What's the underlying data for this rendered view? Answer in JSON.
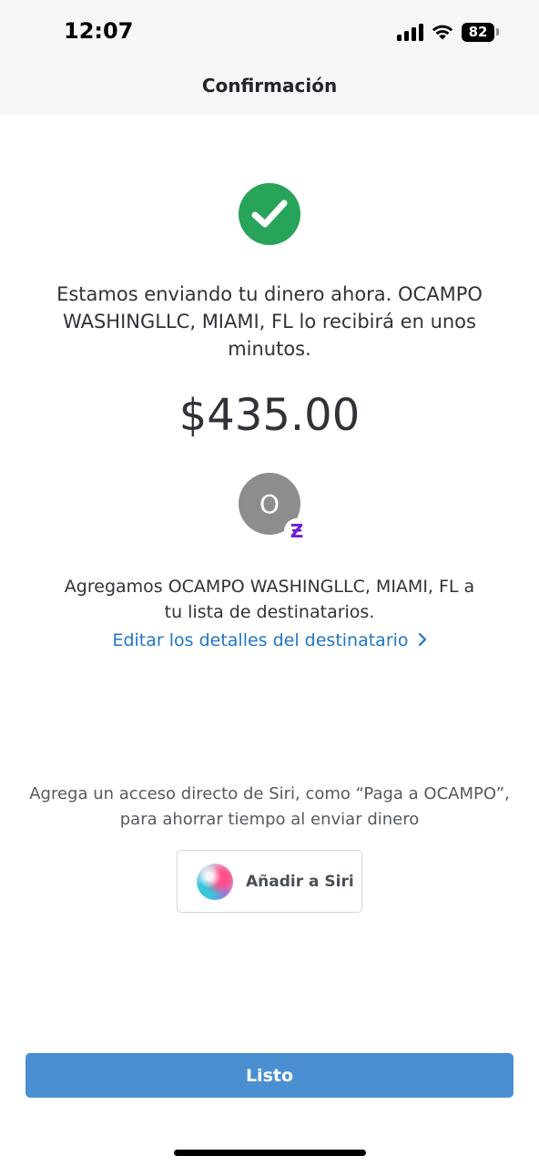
{
  "status_bar": {
    "time": "12:07",
    "battery_level": "82",
    "icons": [
      "signal-icon",
      "wifi-icon",
      "battery-icon"
    ]
  },
  "header": {
    "title": "Confirmación"
  },
  "confirmation": {
    "icon": "check-circle-icon",
    "message": "Estamos enviando tu dinero ahora. OCAMPO WASHINGLLC, MIAMI, FL lo recibirá en unos minutos.",
    "amount": "$435.00"
  },
  "recipient": {
    "avatar_initial": "O",
    "badge_symbol": "Ƶ",
    "added_text": "Agregamos OCAMPO WASHINGLLC, MIAMI, FL a tu lista de destinatarios.",
    "edit_link_label": "Editar los detalles del destinatario"
  },
  "siri": {
    "hint": "Agrega un acceso directo de Siri, como “Paga a OCAMPO”, para ahorrar tiempo al enviar dinero",
    "button_label": "Añadir a Siri"
  },
  "footer": {
    "done_label": "Listo"
  },
  "colors": {
    "success_green": "#27a35a",
    "link_blue": "#1f76c6",
    "primary_button": "#4a8fd1",
    "zelle_purple": "#6d1ed4"
  }
}
